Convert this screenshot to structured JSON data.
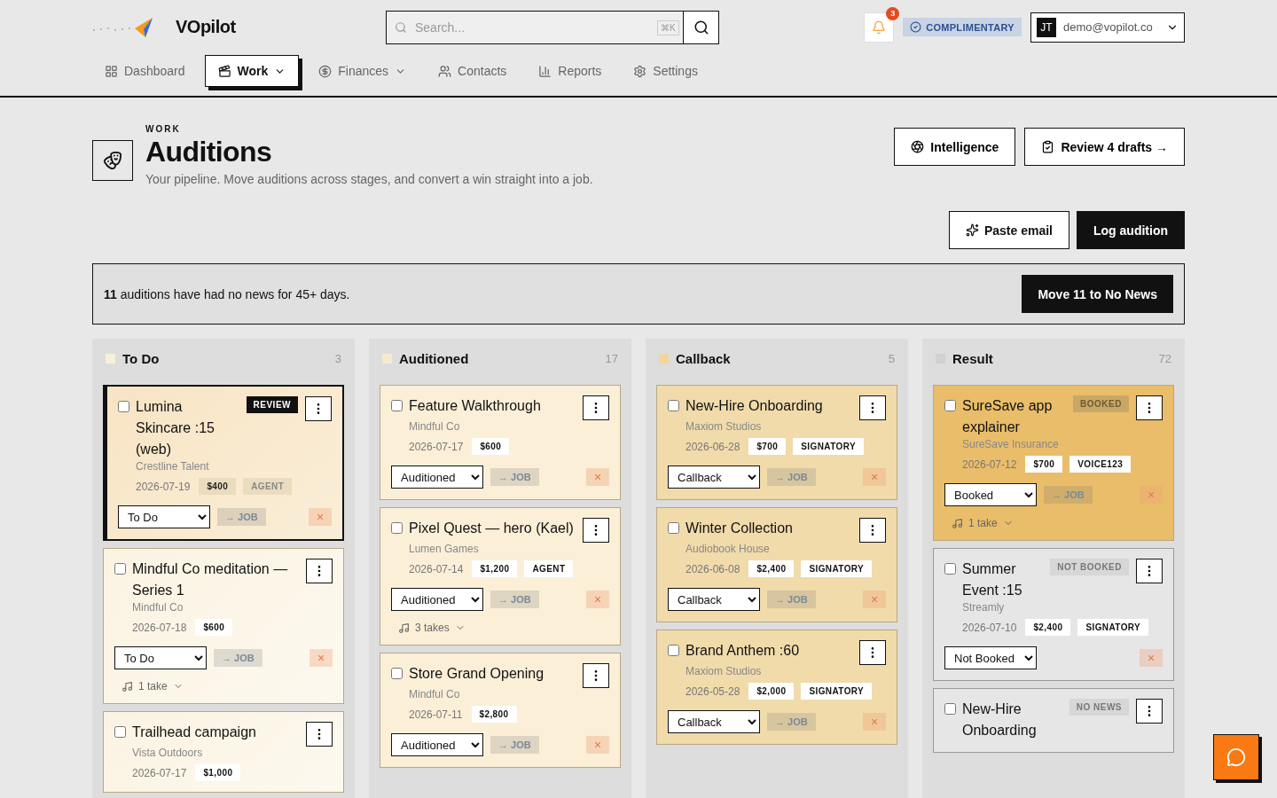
{
  "brand": {
    "name": "VOpilot"
  },
  "search": {
    "placeholder": "Search...",
    "shortcut": "⌘K"
  },
  "notifications": {
    "count": "3"
  },
  "plan": {
    "label": "COMPLIMENTARY"
  },
  "account": {
    "initials": "JT",
    "email": "demo@vopilot.co"
  },
  "nav": [
    {
      "label": "Dashboard",
      "selected": false,
      "dropdown": false
    },
    {
      "label": "Work",
      "selected": true,
      "dropdown": true
    },
    {
      "label": "Finances",
      "selected": false,
      "dropdown": true
    },
    {
      "label": "Contacts",
      "selected": false,
      "dropdown": false
    },
    {
      "label": "Reports",
      "selected": false,
      "dropdown": false
    },
    {
      "label": "Settings",
      "selected": false,
      "dropdown": false
    }
  ],
  "header": {
    "eyebrow": "WORK",
    "title": "Auditions",
    "subtitle": "Your pipeline. Move auditions across stages, and convert a win straight into a job."
  },
  "header_actions": [
    "Intelligence",
    "Review 4 drafts →"
  ],
  "toolbar": [
    {
      "label": "Paste email",
      "kind": "outline"
    },
    {
      "label": "Log audition",
      "kind": "primary"
    }
  ],
  "banner": {
    "message": "**11** auditions have had no news for 45+ days.",
    "action": "Move 11 to No News"
  },
  "columns": [
    {
      "name": "To Do",
      "count": "3",
      "color": "#f6efd9",
      "cards": [
        {
          "title": "Lumina Skincare :15 (web)",
          "client": "Crestline Talent",
          "date": "2026-07-19",
          "fee": "$400",
          "tags": [
            "AGENT"
          ],
          "badge": {
            "text": "REVIEW",
            "kind": "review"
          },
          "stage": "To Do",
          "job": "→ JOB",
          "close": "×",
          "kind": "review",
          "highlighted": true,
          "checked": false
        },
        {
          "title": "Mindful Co meditation — Series 1",
          "client": "Mindful Co",
          "date": "2026-07-18",
          "fee": "$600",
          "stage": "To Do",
          "job": "→ JOB",
          "close": "×",
          "takes": "1 take",
          "kind": "todo",
          "highlighted": false,
          "checked": false
        },
        {
          "title": "Trailhead campaign",
          "client": "Vista Outdoors",
          "date": "2026-07-17",
          "fee": "$1,000",
          "kind": "todo",
          "highlighted": false,
          "checked": false
        }
      ]
    },
    {
      "name": "Auditioned",
      "count": "17",
      "color": "#f7ead0",
      "cards": [
        {
          "title": "Feature Walkthrough",
          "client": "Mindful Co",
          "date": "2026-07-17",
          "fee": "$600",
          "stage": "Auditioned",
          "job": "→ JOB",
          "close": "×",
          "kind": "auditioned",
          "highlighted": false,
          "checked": false
        },
        {
          "title": "Pixel Quest — hero (Kael)",
          "client": "Lumen Games",
          "date": "2026-07-14",
          "fee": "$1,200",
          "tags": [
            "AGENT"
          ],
          "stage": "Auditioned",
          "job": "→ JOB",
          "close": "×",
          "takes": "3 takes",
          "kind": "auditioned",
          "highlighted": false,
          "checked": false
        },
        {
          "title": "Store Grand Opening",
          "client": "Mindful Co",
          "date": "2026-07-11",
          "fee": "$2,800",
          "stage": "Auditioned",
          "job": "→ JOB",
          "close": "×",
          "kind": "auditioned",
          "highlighted": false,
          "checked": false
        }
      ]
    },
    {
      "name": "Callback",
      "count": "5",
      "color": "#f2d59a",
      "cards": [
        {
          "title": "New-Hire Onboarding",
          "client": "Maxiom Studios",
          "date": "2026-06-28",
          "fee": "$700",
          "tags": [
            "SIGNATORY"
          ],
          "stage": "Callback",
          "job": "→ JOB",
          "close": "×",
          "kind": "callback",
          "highlighted": false,
          "checked": false
        },
        {
          "title": "Winter Collection",
          "client": "Audiobook House",
          "date": "2026-06-08",
          "fee": "$2,400",
          "tags": [
            "SIGNATORY"
          ],
          "stage": "Callback",
          "job": "→ JOB",
          "close": "×",
          "kind": "callback",
          "highlighted": false,
          "checked": false
        },
        {
          "title": "Brand Anthem :60",
          "client": "Maxiom Studios",
          "date": "2026-05-28",
          "fee": "$2,000",
          "tags": [
            "SIGNATORY"
          ],
          "stage": "Callback",
          "job": "→ JOB",
          "close": "×",
          "kind": "callback",
          "highlighted": false,
          "checked": false
        }
      ]
    },
    {
      "name": "Result",
      "count": "72",
      "color": "#d2d2d2",
      "cards": [
        {
          "title": "SureSave app explainer",
          "client": "SureSave Insurance",
          "date": "2026-07-12",
          "fee": "$700",
          "tags": [
            "VOICE123"
          ],
          "badge": {
            "text": "BOOKED",
            "kind": "booked"
          },
          "stage": "Booked",
          "job": "→ JOB",
          "close": "×",
          "takes": "1 take",
          "kind": "booked",
          "highlighted": false,
          "checked": false
        },
        {
          "title": "Summer Event :15",
          "client": "Streamly",
          "date": "2026-07-10",
          "fee": "$2,400",
          "tags": [
            "SIGNATORY"
          ],
          "badge": {
            "text": "NOT BOOKED",
            "kind": "muted"
          },
          "stage": "Not Booked",
          "close": "×",
          "kind": "neutral",
          "highlighted": false,
          "checked": false
        },
        {
          "title": "New-Hire Onboarding",
          "badge": {
            "text": "NO NEWS",
            "kind": "muted"
          },
          "kind": "neutral",
          "highlighted": false,
          "checked": false
        }
      ]
    }
  ]
}
